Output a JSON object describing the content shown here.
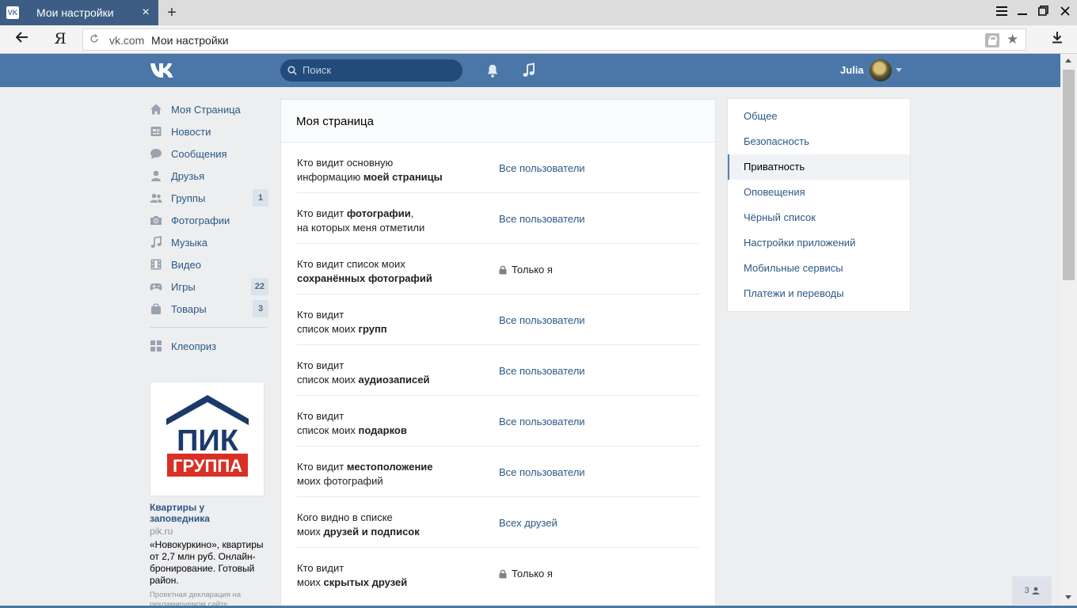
{
  "browser": {
    "tab_title": "Мои настройки",
    "favicon": "VK",
    "address_domain": "vk.com",
    "address_title": "Мои настройки",
    "yandex_button": "Я"
  },
  "header": {
    "search_placeholder": "Поиск",
    "user_name": "Julia"
  },
  "sidebar": {
    "items": [
      {
        "label": "Моя Страница",
        "icon": "home-icon",
        "badge": ""
      },
      {
        "label": "Новости",
        "icon": "news-icon",
        "badge": ""
      },
      {
        "label": "Сообщения",
        "icon": "messages-icon",
        "badge": ""
      },
      {
        "label": "Друзья",
        "icon": "friends-icon",
        "badge": ""
      },
      {
        "label": "Группы",
        "icon": "groups-icon",
        "badge": "1"
      },
      {
        "label": "Фотографии",
        "icon": "camera-icon",
        "badge": ""
      },
      {
        "label": "Музыка",
        "icon": "music-icon",
        "badge": ""
      },
      {
        "label": "Видео",
        "icon": "video-icon",
        "badge": ""
      },
      {
        "label": "Игры",
        "icon": "gamepad-icon",
        "badge": "22"
      },
      {
        "label": "Товары",
        "icon": "bag-icon",
        "badge": "3"
      }
    ],
    "apps": [
      {
        "label": "Клеоприз",
        "icon": "apps-icon"
      }
    ]
  },
  "ad": {
    "logo_top": "ПИК",
    "logo_bottom": "ГРУППА",
    "title": "Квартиры у заповедника",
    "domain": "pik.ru",
    "text": "«Новокуркино», квартиры от 2,7 млн руб. Онлайн-бронирование. Готовый район.",
    "note": "Проектная декларация на рекламируемом сайте"
  },
  "main": {
    "title": "Моя страница",
    "rows": [
      {
        "q1": "Кто видит основную",
        "q2a": "информацию ",
        "q2b": "моей страницы",
        "q2c": "",
        "answer": "Все пользователи",
        "locked": false
      },
      {
        "q1a": "Кто видит ",
        "q1b": "фотографии",
        "q1c": ",",
        "q2": "на которых меня отметили",
        "answer": "Все пользователи",
        "locked": false
      },
      {
        "q1": "Кто видит список моих",
        "q2b": "сохранённых фотографий",
        "answer": "Только я",
        "locked": true
      },
      {
        "q1": "Кто видит",
        "q2a": "список моих ",
        "q2b": "групп",
        "answer": "Все пользователи",
        "locked": false
      },
      {
        "q1": "Кто видит",
        "q2a": "список моих ",
        "q2b": "аудиозаписей",
        "answer": "Все пользователи",
        "locked": false
      },
      {
        "q1": "Кто видит",
        "q2a": "список моих ",
        "q2b": "подарков",
        "answer": "Все пользователи",
        "locked": false
      },
      {
        "q1a": "Кто видит ",
        "q1b": "местоположение",
        "q2": "моих фотографий",
        "answer": "Все пользователи",
        "locked": false
      },
      {
        "q1": "Кого видно в списке",
        "q2a": "моих ",
        "q2b": "друзей и подписок",
        "answer": "Всех друзей",
        "locked": false
      },
      {
        "q1": "Кто видит",
        "q2a": "моих ",
        "q2b": "скрытых друзей",
        "answer": "Только я",
        "locked": true
      }
    ]
  },
  "settings_nav": {
    "items": [
      "Общее",
      "Безопасность",
      "Приватность",
      "Оповещения",
      "Чёрный список",
      "Настройки приложений",
      "Мобильные сервисы",
      "Платежи и переводы"
    ],
    "active_index": 2
  },
  "online_widget": {
    "count": "3"
  },
  "colors": {
    "header_blue": "#4a76a8",
    "link_blue": "#2a5885",
    "background": "#edeef0"
  }
}
